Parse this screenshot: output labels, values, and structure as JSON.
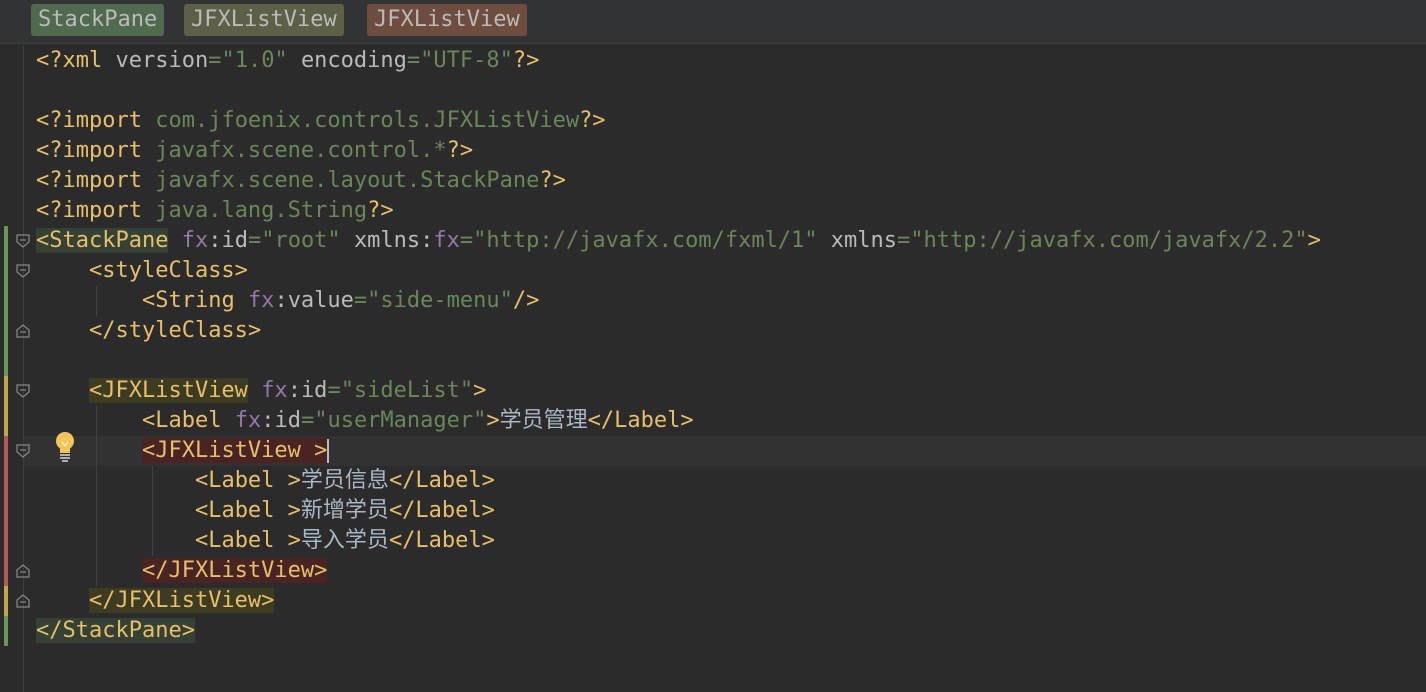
{
  "breadcrumbs": [
    "StackPane",
    "JFXListView",
    "JFXListView"
  ],
  "code": {
    "xml_decl_open": "<?xml ",
    "xml_version_attr": "version",
    "xml_version_val": "\"1.0\"",
    "xml_encoding_attr": "encoding",
    "xml_encoding_val": "\"UTF-8\"",
    "xml_decl_close": "?>",
    "import_kw": "<?import ",
    "pi_close": "?>",
    "imports": [
      "com.jfoenix.controls.JFXListView",
      "javafx.scene.control.*",
      "javafx.scene.layout.StackPane",
      "java.lang.String"
    ],
    "stackpane_open": "<StackPane",
    "stackpane_close": "</StackPane>",
    "fx_prefix": "fx",
    "colon": ":",
    "eq": "=",
    "id_attr": "id",
    "value_attr": "value",
    "root_id": "\"root\"",
    "xmlns_attr": "xmlns",
    "xmlns_fx_val": "\"http://javafx.com/fxml/1\"",
    "xmlns_val": "\"http://javafx.com/javafx/2.2\"",
    "gt": ">",
    "styleclass_open": "<styleClass>",
    "styleclass_close": "</styleClass>",
    "string_open": "<String",
    "side_menu_val": "\"side-menu\"",
    "self_close": "/>",
    "jfx_open": "<JFXListView",
    "jfx_close": "</JFXListView>",
    "sidelist_val": "\"sideList\"",
    "label_open": "<Label",
    "label_close": "</Label>",
    "usermanager_val": "\"userManager\"",
    "label_user_manager": "学员管理",
    "inner_jfx_open": "<JFXListView >",
    "label_open_sp": "<Label >",
    "labels": [
      "学员信息",
      "新增学员",
      "导入学员"
    ]
  },
  "colors": {
    "background": "#2b2b2b",
    "tag": "#e8bf6a",
    "string": "#6a8759",
    "namespace": "#9876aa",
    "text": "#a9b7c6",
    "change_green": "#6a9955",
    "change_yellow": "#bda84b",
    "change_red": "#b05a5a"
  },
  "icons": [
    "fold-marker-icon",
    "intention-bulb-icon"
  ]
}
